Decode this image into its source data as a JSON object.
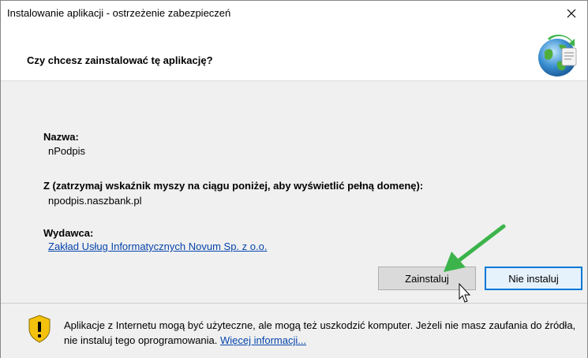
{
  "window": {
    "title": "Instalowanie aplikacji - ostrzeżenie zabezpieczeń"
  },
  "header": {
    "question": "Czy chcesz zainstalować tę aplikację?"
  },
  "details": {
    "name_label": "Nazwa:",
    "name_value": "nPodpis",
    "from_label": "Z (zatrzymaj wskaźnik myszy na ciągu poniżej, aby wyświetlić pełną domenę):",
    "from_value": "npodpis.naszbank.pl",
    "publisher_label": "Wydawca:",
    "publisher_value": "Zakład Usług Informatycznych Novum Sp. z o.o."
  },
  "buttons": {
    "install": "Zainstaluj",
    "no_install": "Nie instaluj"
  },
  "footer": {
    "warning_text": "Aplikacje z Internetu mogą być użyteczne, ale mogą też uszkodzić komputer. Jeżeli nie masz zaufania do źródła, nie instaluj tego oprogramowania. ",
    "more_info_link": "Więcej informacji..."
  },
  "colors": {
    "link": "#0645ad",
    "default_button_border": "#0078d7",
    "annotation_arrow": "#3cb44b"
  },
  "icons": {
    "close": "close-icon",
    "globe": "globe-install-icon",
    "shield": "warning-shield-icon",
    "arrow": "green-arrow-annotation",
    "cursor": "mouse-cursor"
  }
}
